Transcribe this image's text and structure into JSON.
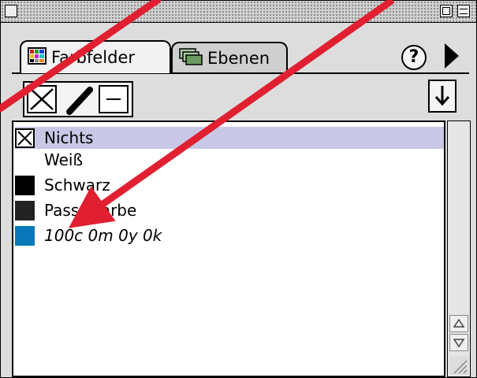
{
  "tabs": [
    {
      "label": "Farbfelder",
      "icon": "swatch-grid-icon"
    },
    {
      "label": "Ebenen",
      "icon": "layers-icon"
    }
  ],
  "help_label": "?",
  "toolbar": {
    "icons": [
      "none-swatch-icon",
      "stroke-pen-icon",
      "fill-box-icon"
    ],
    "new_swatch_icon": "new-swatch-icon"
  },
  "swatches": [
    {
      "name": "Nichts",
      "color": "none",
      "selected": true
    },
    {
      "name": "Weiß",
      "color": "#ffffff"
    },
    {
      "name": "Schwarz",
      "color": "#000000"
    },
    {
      "name": "Passerfarbe",
      "color": "#222222"
    },
    {
      "name": "100c 0m 0y 0k",
      "color": "#0a78b8",
      "italic": true
    }
  ],
  "annotation": {
    "arrow_color": "#e02030"
  }
}
